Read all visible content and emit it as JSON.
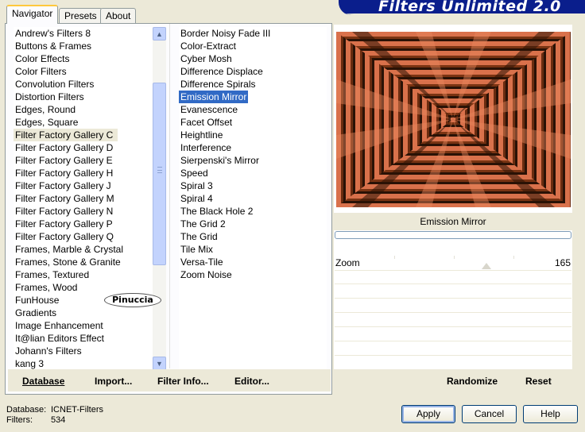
{
  "banner": {
    "title": "Filters Unlimited 2.0"
  },
  "tabs": [
    {
      "label": "Navigator",
      "active": true
    },
    {
      "label": "Presets"
    },
    {
      "label": "About"
    }
  ],
  "categories": [
    "Andrew's Filters 8",
    "Buttons & Frames",
    "Color Effects",
    "Color Filters",
    "Convolution Filters",
    "Distortion Filters",
    "Edges, Round",
    "Edges, Square",
    "Filter Factory Gallery C",
    "Filter Factory Gallery D",
    "Filter Factory Gallery E",
    "Filter Factory Gallery H",
    "Filter Factory Gallery J",
    "Filter Factory Gallery M",
    "Filter Factory Gallery N",
    "Filter Factory Gallery P",
    "Filter Factory Gallery Q",
    "Frames, Marble & Crystal",
    "Frames, Stone & Granite",
    "Frames, Textured",
    "Frames, Wood",
    "FunHouse",
    "Gradients",
    "Image Enhancement",
    "It@lian Editors Effect",
    "Johann's Filters",
    "kang 3"
  ],
  "selected_category": "Filter Factory Gallery C",
  "filters": [
    "Border Noisy Fade III",
    "Color-Extract",
    "Cyber Mosh",
    "Difference Displace",
    "Difference Spirals",
    "Emission Mirror",
    "Evanescence",
    "Facet Offset",
    "Heightline",
    "Interference",
    "Sierpenski's Mirror",
    "Speed",
    "Spiral 3",
    "Spiral 4",
    "The Black Hole 2",
    "The Grid 2",
    "The Grid",
    "Tile Mix",
    "Versa-Tile",
    "Zoom Noise"
  ],
  "selected_filter": "Emission Mirror",
  "watermark": "Pinuccia",
  "left_buttons": {
    "database": "Database",
    "import": "Import...",
    "filter_info": "Filter Info...",
    "editor": "Editor..."
  },
  "preview": {
    "filter_name": "Emission Mirror"
  },
  "params": [
    {
      "label": "Zoom",
      "value": "165"
    }
  ],
  "right_buttons": {
    "randomize": "Randomize",
    "reset": "Reset"
  },
  "status": {
    "database_label": "Database:",
    "database_value": "ICNET-Filters",
    "filters_label": "Filters:",
    "filters_value": "534"
  },
  "dialog_buttons": {
    "apply": "Apply",
    "cancel": "Cancel",
    "help": "Help"
  },
  "colors": {
    "banner": "#0a1e8c",
    "selection": "#316ac5",
    "preview_light": "#d9714b",
    "preview_dark": "#2a1206"
  }
}
